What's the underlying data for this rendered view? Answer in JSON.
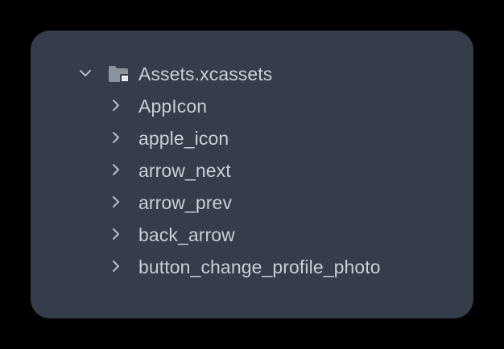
{
  "colors": {
    "background": "#000000",
    "panel": "#363d4a",
    "text": "#c9ced6",
    "icon": "#b9bec6"
  },
  "tree": {
    "root": {
      "label": "Assets.xcassets",
      "expanded": true,
      "icon": "folder-icon"
    },
    "children": [
      {
        "label": "AppIcon",
        "expanded": false,
        "icon": "chevron-right-icon"
      },
      {
        "label": "apple_icon",
        "expanded": false,
        "icon": "chevron-right-icon"
      },
      {
        "label": "arrow_next",
        "expanded": false,
        "icon": "chevron-right-icon"
      },
      {
        "label": "arrow_prev",
        "expanded": false,
        "icon": "chevron-right-icon"
      },
      {
        "label": "back_arrow",
        "expanded": false,
        "icon": "chevron-right-icon"
      },
      {
        "label": "button_change_profile_photo",
        "expanded": false,
        "icon": "chevron-right-icon"
      }
    ]
  }
}
